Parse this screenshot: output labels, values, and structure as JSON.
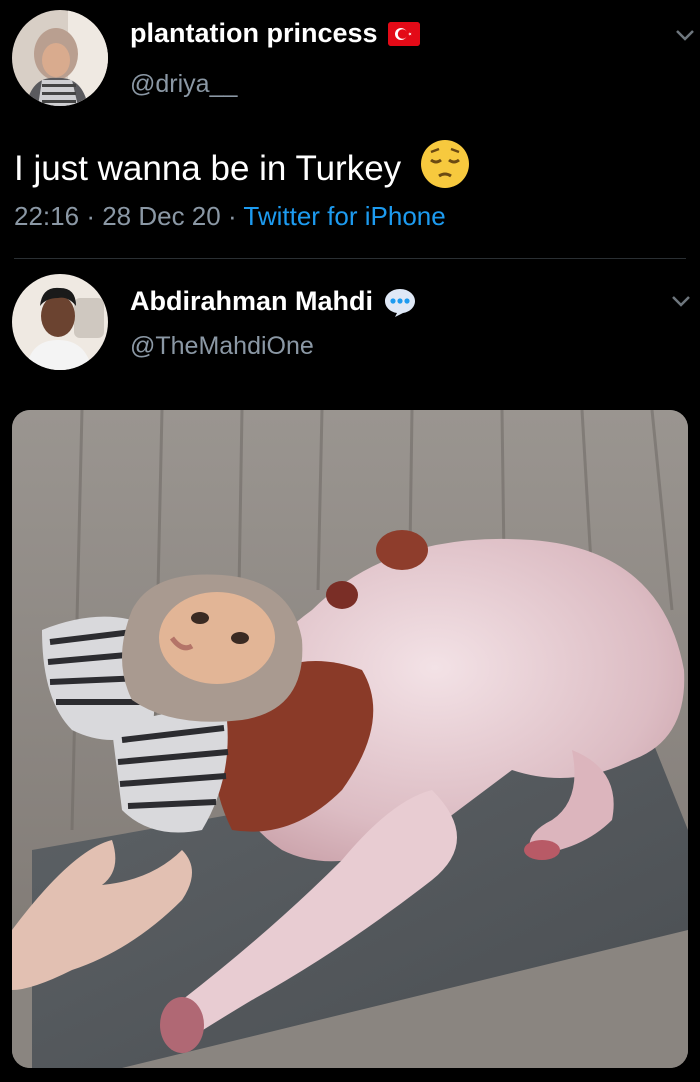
{
  "tweet1": {
    "name": "plantation princess",
    "handle": "@driya__",
    "text": "I just wanna be in Turkey",
    "time": "22:16",
    "date": "28 Dec 20",
    "source": "Twitter for iPhone",
    "emoji": "pensive-face",
    "badge": "turkey-flag"
  },
  "tweet2": {
    "name": "Abdirahman Mahdi",
    "handle": "@TheMahdiOne",
    "badge": "speech-bubble"
  },
  "colors": {
    "background": "#000000",
    "muted": "#8b98a5",
    "link": "#1d9bf0"
  }
}
